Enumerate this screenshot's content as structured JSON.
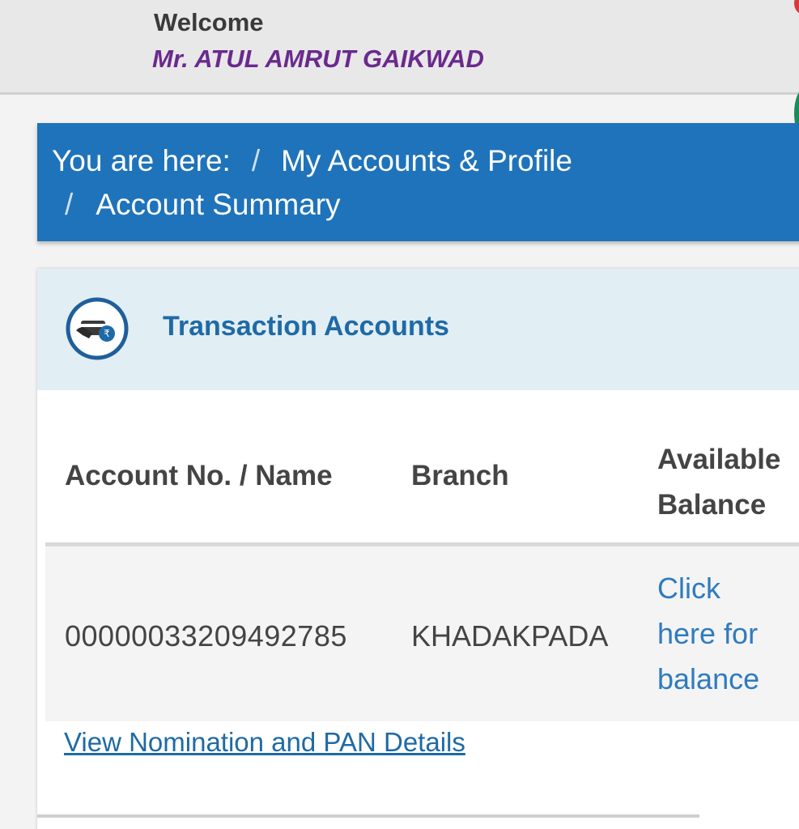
{
  "header": {
    "welcome": "Welcome",
    "user_name": "Mr. ATUL AMRUT GAIKWAD"
  },
  "breadcrumb": {
    "prefix": "You are here:",
    "separator": "/",
    "items": [
      "My Accounts & Profile",
      "Account Summary"
    ]
  },
  "transaction_accounts": {
    "title": "Transaction Accounts",
    "icon": "card-payment-icon",
    "columns": {
      "account": "Account No. / Name",
      "branch": "Branch",
      "balance_line1": "Available",
      "balance_line2": "Balance"
    },
    "rows": [
      {
        "account": "00000033209492785",
        "branch": "KHADAKPADA",
        "balance_line1": "Click",
        "balance_line2": "here for",
        "balance_line3": "balance"
      }
    ],
    "nomination_link": "View Nomination and PAN Details"
  },
  "colors": {
    "accent_blue": "#1f73ba",
    "user_name_purple": "#6a2a8e",
    "link_blue": "#2f7bbf",
    "card_header_bg": "#e1eef4"
  }
}
